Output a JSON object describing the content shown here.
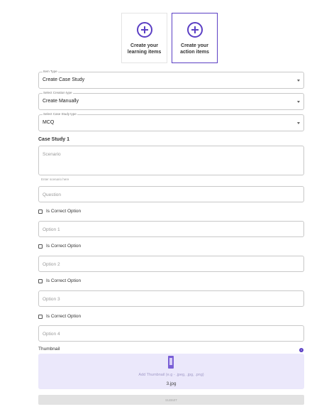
{
  "cards": [
    {
      "label_line1": "Create your",
      "label_line2": "learning items"
    },
    {
      "label_line1": "Create your",
      "label_line2": "action items"
    }
  ],
  "item_type": {
    "legend": "Item Type",
    "value": "Create Case Study"
  },
  "creation_type": {
    "legend": "Select Creation type",
    "value": "Create Manually"
  },
  "case_study_type": {
    "legend": "Select Case Study type",
    "value": "MCQ"
  },
  "case_study_heading": "Case Study 1",
  "scenario": {
    "placeholder": "Scenario",
    "helper": "Enter scenario here"
  },
  "question": {
    "placeholder": "Question"
  },
  "options": [
    {
      "check_label": "Is Correct Option",
      "placeholder": "Option 1"
    },
    {
      "check_label": "Is Correct Option",
      "placeholder": "Option 2"
    },
    {
      "check_label": "Is Correct Option",
      "placeholder": "Option 3"
    },
    {
      "check_label": "Is Correct Option",
      "placeholder": "Option 4"
    }
  ],
  "thumbnail": {
    "label": "Thumbnail",
    "info": "i",
    "hint": "Add Thumbnail (e.g - .jpeg, .jpg, .png)",
    "file_name": "3.jpg"
  },
  "submit_label": "SUBMIT",
  "colors": {
    "accent": "#5b3fc4",
    "upload_bg": "#ebe8fb"
  }
}
